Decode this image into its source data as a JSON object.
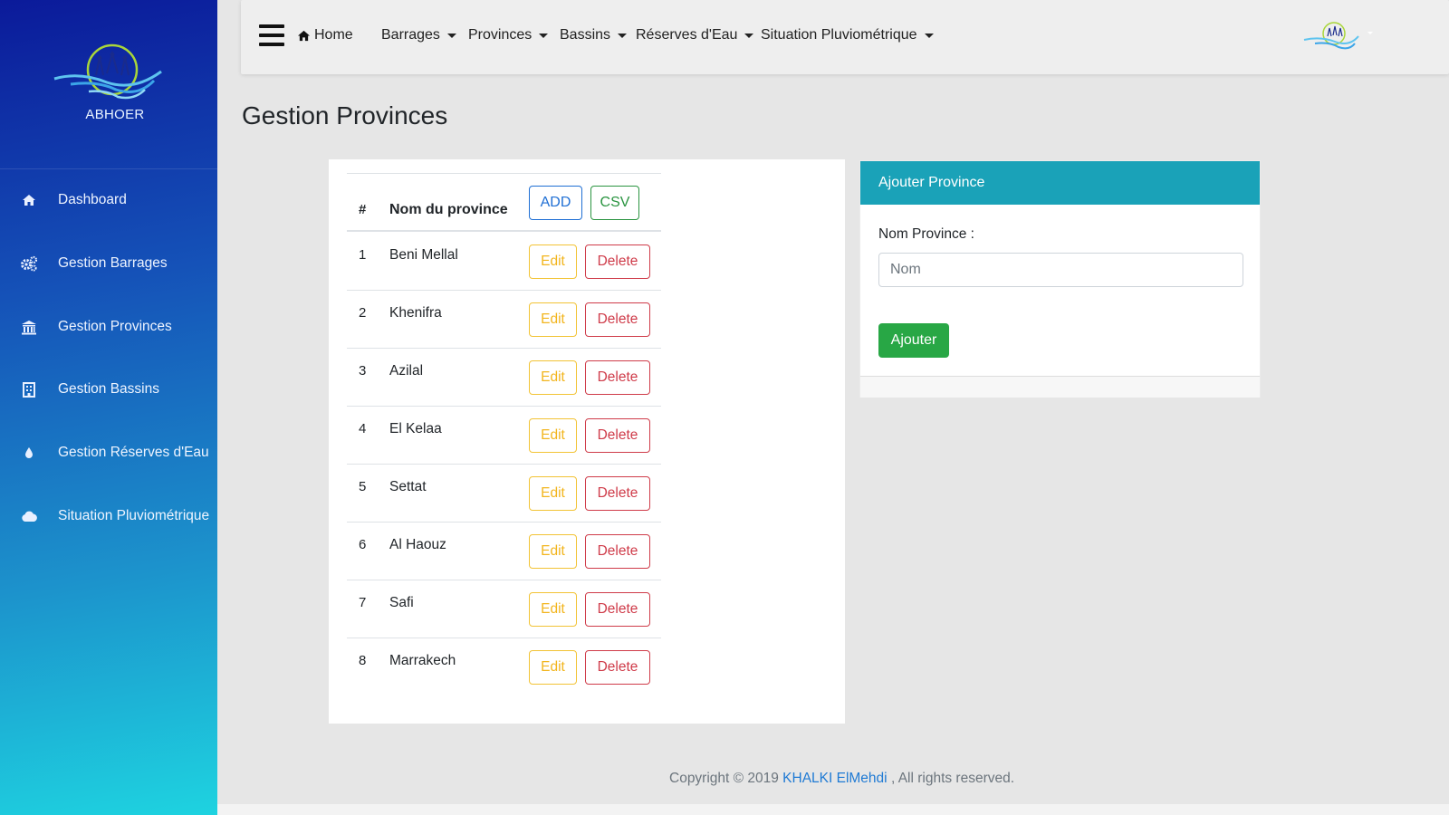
{
  "sidebar": {
    "brand_name": "ABHOER",
    "items": [
      {
        "label": "Dashboard",
        "icon": "home-icon"
      },
      {
        "label": "Gestion Barrages",
        "icon": "cogs-icon"
      },
      {
        "label": "Gestion Provinces",
        "icon": "bank-icon"
      },
      {
        "label": "Gestion Bassins",
        "icon": "building-icon"
      },
      {
        "label": "Gestion Réserves d'Eau",
        "icon": "water-drop-icon"
      },
      {
        "label": "Situation Pluviométrique",
        "icon": "cloud-icon"
      }
    ]
  },
  "navbar": {
    "home": "Home",
    "menus": [
      "Barrages",
      "Provinces",
      "Bassins",
      "Réserves d'Eau",
      "Situation Pluviométrique"
    ]
  },
  "page_title": "Gestion Provinces",
  "table": {
    "headers": {
      "num": "#",
      "name": "Nom du province"
    },
    "add_label": "ADD",
    "csv_label": "CSV",
    "edit_label": "Edit",
    "delete_label": "Delete",
    "rows": [
      {
        "num": "1",
        "name": "Beni Mellal"
      },
      {
        "num": "2",
        "name": "Khenifra"
      },
      {
        "num": "3",
        "name": "Azilal"
      },
      {
        "num": "4",
        "name": "El Kelaa"
      },
      {
        "num": "5",
        "name": "Settat"
      },
      {
        "num": "6",
        "name": "Al Haouz"
      },
      {
        "num": "7",
        "name": "Safi"
      },
      {
        "num": "8",
        "name": "Marrakech"
      }
    ]
  },
  "form": {
    "title": "Ajouter Province",
    "label": "Nom Province :",
    "placeholder": "Nom",
    "submit": "Ajouter"
  },
  "footer": {
    "prefix": "Copyright © 2019",
    "author": "KHALKI ElMehdi",
    "suffix": ", All rights reserved."
  },
  "colors": {
    "sidebar_top": "#0b1a9a",
    "sidebar_bottom": "#1ed3e0",
    "form_header": "#1aa2b8",
    "submit": "#28a745",
    "edit": "#f2b51e",
    "delete": "#cf3b49",
    "add": "#1f6fd4",
    "csv": "#2a9440"
  }
}
